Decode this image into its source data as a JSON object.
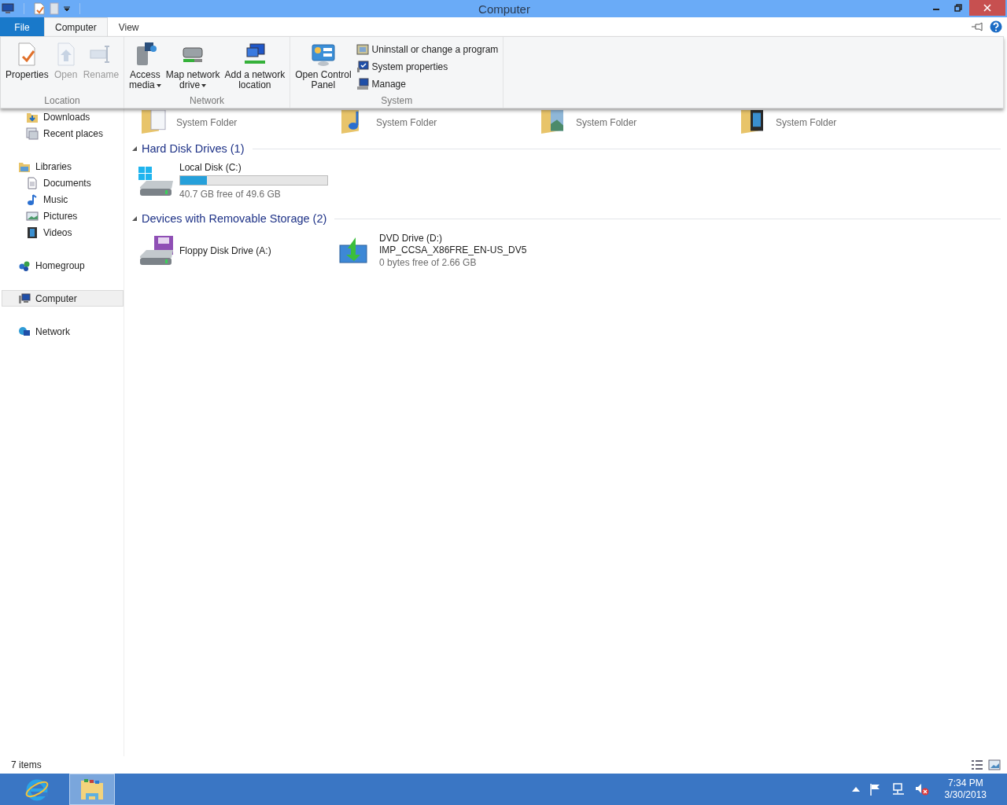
{
  "window": {
    "title": "Computer"
  },
  "tabs": [
    {
      "label": "File",
      "kind": "file",
      "selected": false
    },
    {
      "label": "Computer",
      "kind": "tab",
      "selected": true
    },
    {
      "label": "View",
      "kind": "tab",
      "selected": false
    }
  ],
  "ribbon_groups": [
    {
      "label": "Location",
      "buttons": [
        {
          "label": "Properties",
          "disabled": false,
          "dropdown": false
        },
        {
          "label": "Open",
          "disabled": true,
          "dropdown": false
        },
        {
          "label": "Rename",
          "disabled": true,
          "dropdown": false
        }
      ]
    },
    {
      "label": "Network",
      "buttons": [
        {
          "label": "Access\nmedia",
          "disabled": false,
          "dropdown": true
        },
        {
          "label": "Map network\ndrive",
          "disabled": false,
          "dropdown": true
        },
        {
          "label": "Add a network\nlocation",
          "disabled": false,
          "dropdown": false
        }
      ]
    },
    {
      "label": "System",
      "buttons": [
        {
          "label": "Open Control\nPanel",
          "disabled": false,
          "dropdown": false
        }
      ],
      "small_buttons": [
        {
          "label": "Uninstall or change a program"
        },
        {
          "label": "System properties"
        },
        {
          "label": "Manage"
        }
      ]
    }
  ],
  "sidebar": [
    {
      "items": [
        {
          "label": "Downloads",
          "indent": true,
          "selected": false
        },
        {
          "label": "Recent places",
          "indent": true,
          "selected": false
        }
      ]
    },
    {
      "items": [
        {
          "label": "Libraries",
          "indent": false,
          "selected": false,
          "children": [
            {
              "label": "Documents",
              "selected": false
            },
            {
              "label": "Music",
              "selected": false
            },
            {
              "label": "Pictures",
              "selected": false
            },
            {
              "label": "Videos",
              "selected": false
            }
          ]
        }
      ]
    },
    {
      "items": [
        {
          "label": "Homegroup",
          "indent": false,
          "selected": false
        }
      ]
    },
    {
      "items": [
        {
          "label": "Computer",
          "indent": false,
          "selected": true
        }
      ]
    },
    {
      "items": [
        {
          "label": "Network",
          "indent": false,
          "selected": false
        }
      ]
    }
  ],
  "folders": [
    {
      "detail": "System Folder"
    },
    {
      "detail": "System Folder"
    },
    {
      "detail": "System Folder"
    },
    {
      "detail": "System Folder"
    }
  ],
  "groups": [
    {
      "heading": "Hard Disk Drives (1)",
      "items": [
        {
          "kind": "disk",
          "name": "Local Disk (C:)",
          "level": 0.18,
          "detail": "40.7 GB free of 49.6 GB"
        }
      ]
    },
    {
      "heading": "Devices with Removable Storage (2)",
      "items": [
        {
          "kind": "floppy",
          "name": "Floppy Disk Drive (A:)"
        },
        {
          "kind": "dvd",
          "name": "DVD Drive (D:)",
          "label": "IMP_CCSA_X86FRE_EN-US_DV5",
          "detail": "0 bytes free of 2.66 GB"
        }
      ]
    }
  ],
  "status": {
    "count": "7 items"
  },
  "taskbar": {
    "apps": [
      {
        "kind": "browser",
        "selected": false
      },
      {
        "kind": "explorer",
        "selected": true
      }
    ],
    "time": "7:34 PM",
    "date": "3/30/2013"
  }
}
